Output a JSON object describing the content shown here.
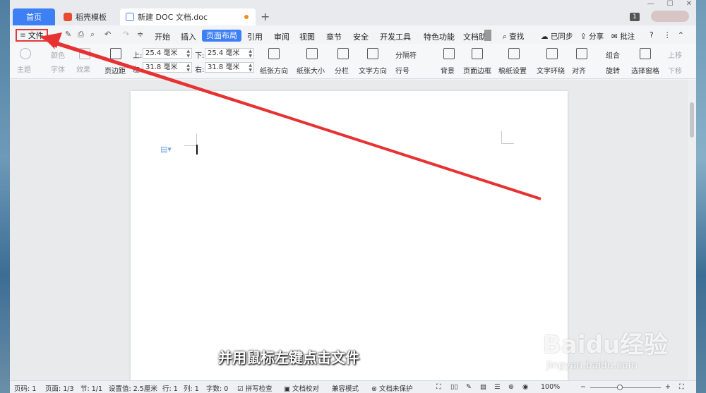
{
  "tabs": [
    {
      "label": "首页"
    },
    {
      "label": "稻壳模板"
    },
    {
      "label": "新建 DOC 文档.doc"
    }
  ],
  "titlebar": {
    "badge": "1"
  },
  "menu": {
    "file": "文件",
    "items": [
      "开始",
      "插入",
      "页面布局",
      "引用",
      "审阅",
      "视图",
      "章节",
      "安全",
      "开发工具",
      "特色功能",
      "文档助"
    ],
    "active": "页面布局",
    "search": "查找",
    "sync": "已同步",
    "share": "分享",
    "comment": "批注"
  },
  "ribbon": {
    "theme": "主题",
    "color": "颜色",
    "font": "字体",
    "effect": "效果",
    "margins": "页边距",
    "top_label": "上:",
    "top_value": "25.4 毫米",
    "bottom_label": "下:",
    "bottom_value": "25.4 毫米",
    "left_label": "左:",
    "left_value": "31.8 毫米",
    "right_label": "右:",
    "right_value": "31.8 毫米",
    "orientation": "纸张方向",
    "size": "纸张大小",
    "columns": "分栏",
    "text_dir": "文字方向",
    "breaks": "分隔符",
    "line_num": "行号",
    "background": "背景",
    "border": "页面边框",
    "grid_paper": "稿纸设置",
    "wrap": "文字环绕",
    "align": "对齐",
    "group": "组合",
    "rotate": "旋转",
    "select_pane": "选择窗格",
    "bring_up": "上移",
    "send_down": "下移"
  },
  "document": {
    "subtitle": "并用鼠标左键点击文件"
  },
  "watermark": {
    "logo": "Baidu经验",
    "url": "jingyan.baidu.com"
  },
  "status": {
    "page_num": "页码: 1",
    "pages": "页面: 1/3",
    "section": "节: 1/1",
    "setting": "设置值: 2.5厘米",
    "row": "行: 1",
    "col": "列: 1",
    "words": "字数: 0",
    "spell": "拼写检查",
    "proof": "文档校对",
    "compat": "兼容模式",
    "protect": "文档未保护",
    "zoom": "100%"
  }
}
